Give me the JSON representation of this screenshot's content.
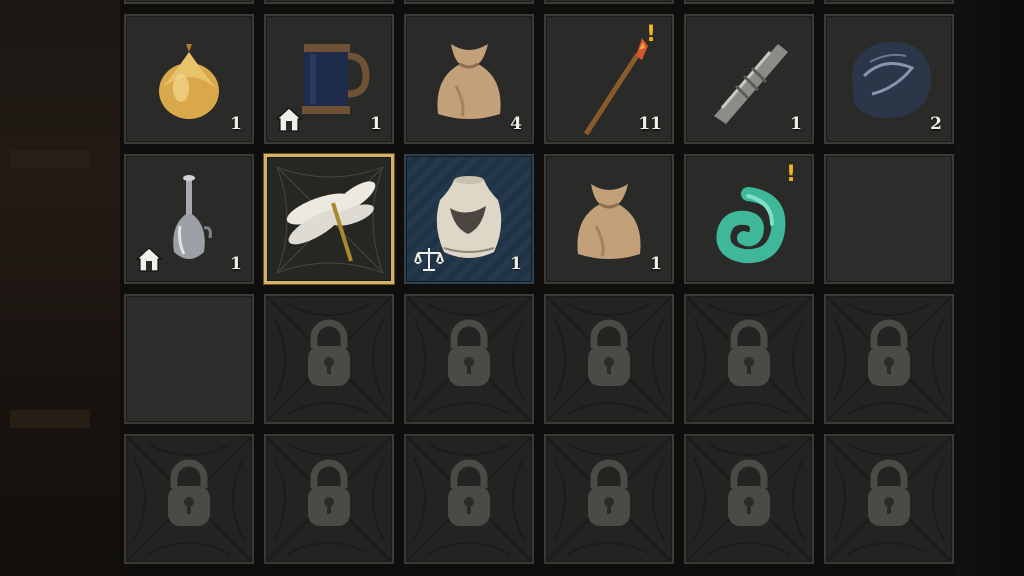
{
  "colors": {
    "selected_border": "#d5b26a",
    "alert": "#f0b324",
    "quantity_text": "#f2eee6",
    "highlight_bg": "#1f3346"
  },
  "row1": [
    {
      "name": "onion",
      "qty": "1"
    },
    {
      "name": "tankard",
      "qty": "1",
      "badge": "home-icon"
    },
    {
      "name": "cloth-pouch",
      "qty": "4"
    },
    {
      "name": "torch-staff",
      "qty": "11",
      "alert": "!"
    },
    {
      "name": "bone-fetish",
      "qty": "1"
    },
    {
      "name": "dark-ore",
      "qty": "2"
    }
  ],
  "row2": [
    {
      "name": "silver-decanter",
      "qty": "1",
      "badge": "home-icon"
    },
    {
      "name": "dragonfly-wings",
      "state": "selected"
    },
    {
      "name": "porcelain-vase",
      "qty": "1",
      "badge": "scales-icon",
      "state": "highlighted"
    },
    {
      "name": "cloth-pouch",
      "qty": "1"
    },
    {
      "name": "jade-pendant",
      "alert": "!"
    },
    {
      "name": "empty-slot"
    }
  ],
  "row3": [
    "empty-slot",
    "locked-slot",
    "locked-slot",
    "locked-slot",
    "locked-slot",
    "locked-slot"
  ],
  "row4": [
    "locked-slot",
    "locked-slot",
    "locked-slot",
    "locked-slot",
    "locked-slot",
    "locked-slot"
  ]
}
